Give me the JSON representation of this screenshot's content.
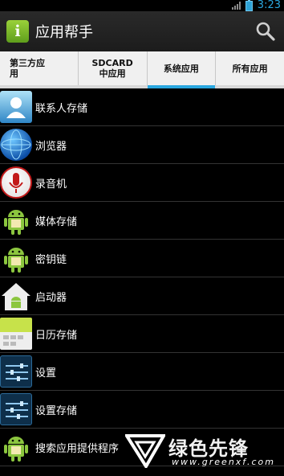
{
  "statusbar": {
    "time": "3:23"
  },
  "header": {
    "icon_letter": "i",
    "title": "应用帮手"
  },
  "tabs": [
    {
      "label": "第三方应\n用",
      "active": false
    },
    {
      "label": "SDCARD\n中应用",
      "active": false
    },
    {
      "label": "系统应用",
      "active": true
    },
    {
      "label": "所有应用",
      "active": false
    }
  ],
  "apps": [
    {
      "label": "联系人存储",
      "icon": "contacts-icon"
    },
    {
      "label": "浏览器",
      "icon": "browser-globe-icon"
    },
    {
      "label": "录音机",
      "icon": "microphone-icon"
    },
    {
      "label": "媒体存储",
      "icon": "android-icon"
    },
    {
      "label": "密钥链",
      "icon": "android-icon"
    },
    {
      "label": "启动器",
      "icon": "home-android-icon"
    },
    {
      "label": "日历存储",
      "icon": "calendar-icon"
    },
    {
      "label": "设置",
      "icon": "settings-icon"
    },
    {
      "label": "设置存储",
      "icon": "settings-icon"
    },
    {
      "label": "搜索应用提供程序",
      "icon": "android-icon"
    }
  ],
  "watermark": {
    "brand": "绿色先锋",
    "url": "www.greenxf.com"
  },
  "colors": {
    "accent": "#2aa7df",
    "tab_bg": "#f0f0f0",
    "app_icon_green": "#7cbb2a"
  }
}
